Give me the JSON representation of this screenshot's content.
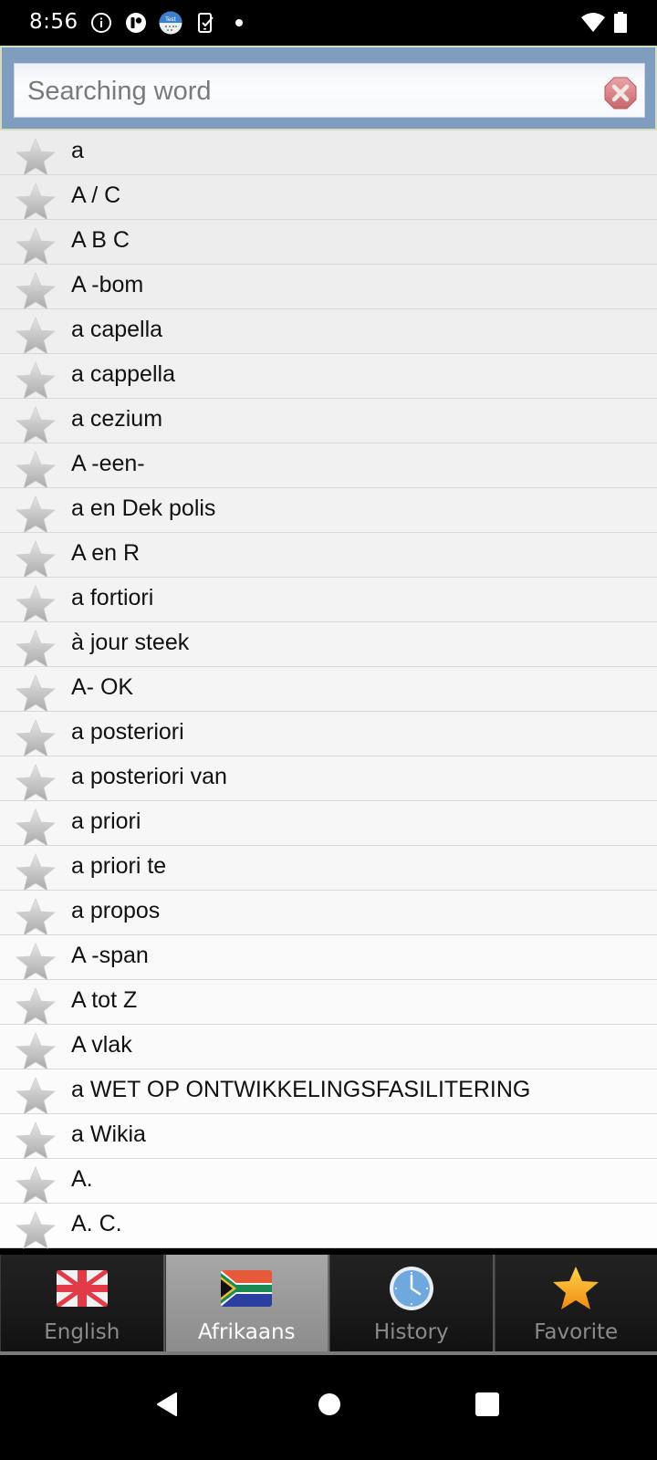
{
  "status_bar": {
    "time": "8:56",
    "notification_icons": [
      "info-icon",
      "app-notification-icon",
      "test-calendar-icon",
      "device-task-icon",
      "dot-icon"
    ],
    "system_icons": [
      "wifi-icon",
      "battery-icon"
    ]
  },
  "search": {
    "placeholder": "Searching word",
    "value": "",
    "clear_icon": "clear-icon"
  },
  "word_list": [
    {
      "word": "a",
      "favorite": false
    },
    {
      "word": "A / C",
      "favorite": false
    },
    {
      "word": "A B C",
      "favorite": false
    },
    {
      "word": "A -bom",
      "favorite": false
    },
    {
      "word": "a capella",
      "favorite": false
    },
    {
      "word": "a cappella",
      "favorite": false
    },
    {
      "word": "a cezium",
      "favorite": false
    },
    {
      "word": "A -een-",
      "favorite": false
    },
    {
      "word": "a en Dek polis",
      "favorite": false
    },
    {
      "word": "A en R",
      "favorite": false
    },
    {
      "word": "a fortiori",
      "favorite": false
    },
    {
      "word": "à jour steek",
      "favorite": false
    },
    {
      "word": "A- OK",
      "favorite": false
    },
    {
      "word": "a posteriori",
      "favorite": false
    },
    {
      "word": "a posteriori van",
      "favorite": false
    },
    {
      "word": "a priori",
      "favorite": false
    },
    {
      "word": "a priori te",
      "favorite": false
    },
    {
      "word": "a propos",
      "favorite": false
    },
    {
      "word": "A -span",
      "favorite": false
    },
    {
      "word": "A tot Z",
      "favorite": false
    },
    {
      "word": "A vlak",
      "favorite": false
    },
    {
      "word": "a WET OP ONTWIKKELINGSFASILITERING",
      "favorite": false
    },
    {
      "word": "a Wikia",
      "favorite": false
    },
    {
      "word": "A.",
      "favorite": false
    },
    {
      "word": "A. C.",
      "favorite": false
    }
  ],
  "tabs": [
    {
      "label": "English",
      "icon": "uk-flag-icon",
      "active": false
    },
    {
      "label": "Afrikaans",
      "icon": "south-africa-flag-icon",
      "active": true
    },
    {
      "label": "History",
      "icon": "clock-icon",
      "active": false
    },
    {
      "label": "Favorite",
      "icon": "star-icon",
      "active": false
    }
  ],
  "nav_bar": [
    "back-icon",
    "home-icon",
    "recents-icon"
  ]
}
